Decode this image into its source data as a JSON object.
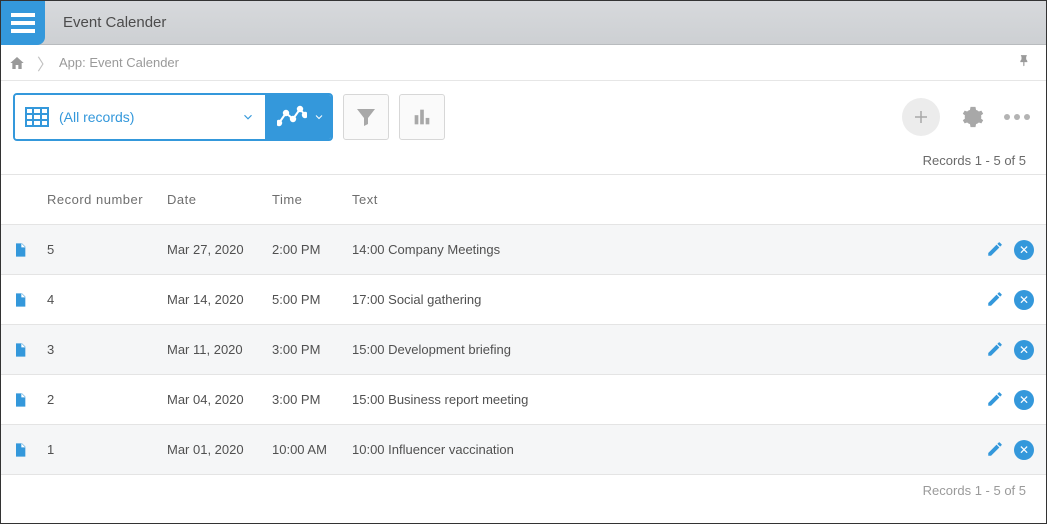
{
  "header": {
    "title": "Event Calender"
  },
  "breadcrumb": {
    "app_label": "App: Event Calender"
  },
  "toolbar": {
    "view_label": "(All records)"
  },
  "records_count_top": "Records 1 - 5 of 5",
  "records_count_bottom": "Records 1 - 5 of 5",
  "columns": {
    "record_number": "Record number",
    "date": "Date",
    "time": "Time",
    "text": "Text"
  },
  "rows": [
    {
      "record_number": "5",
      "date": "Mar 27, 2020",
      "time": "2:00 PM",
      "text": "14:00 Company Meetings"
    },
    {
      "record_number": "4",
      "date": "Mar 14, 2020",
      "time": "5:00 PM",
      "text": "17:00 Social gathering"
    },
    {
      "record_number": "3",
      "date": "Mar 11, 2020",
      "time": "3:00 PM",
      "text": "15:00 Development briefing"
    },
    {
      "record_number": "2",
      "date": "Mar 04, 2020",
      "time": "3:00 PM",
      "text": "15:00 Business report meeting"
    },
    {
      "record_number": "1",
      "date": "Mar 01, 2020",
      "time": "10:00 AM",
      "text": "10:00 Influencer vaccination"
    }
  ]
}
